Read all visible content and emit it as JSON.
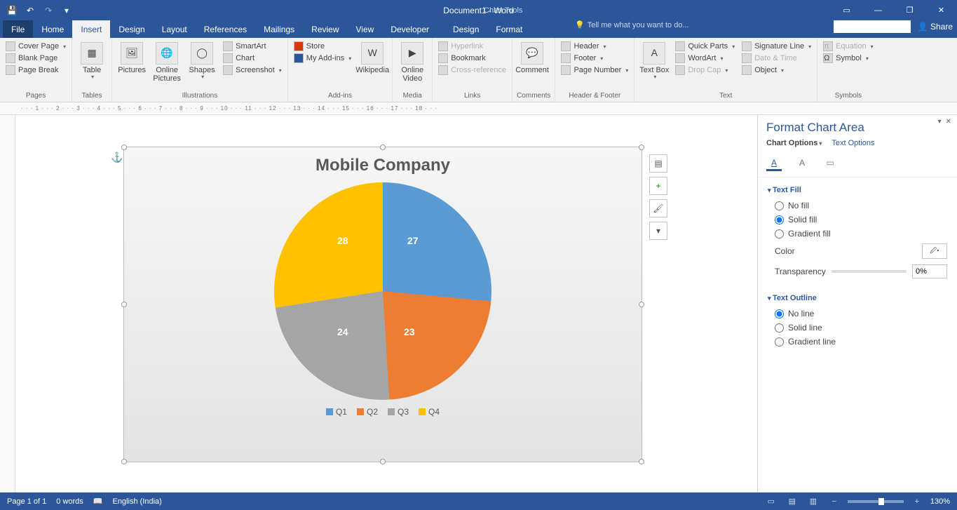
{
  "titlebar": {
    "doc_title": "Document1 - Word",
    "chart_tools": "Chart Tools"
  },
  "tabs": {
    "file": "File",
    "home": "Home",
    "insert": "Insert",
    "design": "Design",
    "layout": "Layout",
    "references": "References",
    "mailings": "Mailings",
    "review": "Review",
    "view": "View",
    "developer": "Developer",
    "ctx_design": "Design",
    "ctx_format": "Format",
    "tellme": "Tell me what you want to do...",
    "share": "Share"
  },
  "ribbon": {
    "pages": {
      "label": "Pages",
      "cover": "Cover Page",
      "blank": "Blank Page",
      "break": "Page Break"
    },
    "tables": {
      "label": "Tables",
      "table": "Table"
    },
    "illustrations": {
      "label": "Illustrations",
      "pictures": "Pictures",
      "online": "Online Pictures",
      "shapes": "Shapes",
      "smartart": "SmartArt",
      "chart": "Chart",
      "screenshot": "Screenshot"
    },
    "addins": {
      "label": "Add-ins",
      "store": "Store",
      "myaddins": "My Add-ins",
      "wikipedia": "Wikipedia"
    },
    "media": {
      "label": "Media",
      "onlinevideo": "Online Video"
    },
    "links": {
      "label": "Links",
      "hyperlink": "Hyperlink",
      "bookmark": "Bookmark",
      "crossref": "Cross-reference"
    },
    "comments": {
      "label": "Comments",
      "comment": "Comment"
    },
    "headerfooter": {
      "label": "Header & Footer",
      "header": "Header",
      "footer": "Footer",
      "pagenumber": "Page Number"
    },
    "text": {
      "label": "Text",
      "textbox": "Text Box",
      "quickparts": "Quick Parts",
      "wordart": "WordArt",
      "dropcap": "Drop Cap",
      "sigline": "Signature Line",
      "datetime": "Date & Time",
      "object": "Object"
    },
    "symbols": {
      "label": "Symbols",
      "equation": "Equation",
      "symbol": "Symbol"
    }
  },
  "chart_data": {
    "type": "pie",
    "title": "Mobile Company",
    "categories": [
      "Q1",
      "Q2",
      "Q3",
      "Q4"
    ],
    "values": [
      27,
      23,
      24,
      28
    ],
    "colors": [
      "#5b9bd5",
      "#ed7d31",
      "#a5a5a5",
      "#ffc000"
    ],
    "legend_position": "bottom"
  },
  "format_pane": {
    "title": "Format Chart Area",
    "chart_options": "Chart Options",
    "text_options": "Text Options",
    "text_fill": {
      "label": "Text Fill",
      "no_fill": "No fill",
      "solid_fill": "Solid fill",
      "gradient_fill": "Gradient fill",
      "selected": "solid_fill",
      "color_label": "Color",
      "transparency_label": "Transparency",
      "transparency_value": "0%"
    },
    "text_outline": {
      "label": "Text Outline",
      "no_line": "No line",
      "solid_line": "Solid line",
      "gradient_line": "Gradient line",
      "selected": "no_line"
    }
  },
  "statusbar": {
    "page": "Page 1 of 1",
    "words": "0 words",
    "lang": "English (India)",
    "zoom": "130%"
  }
}
